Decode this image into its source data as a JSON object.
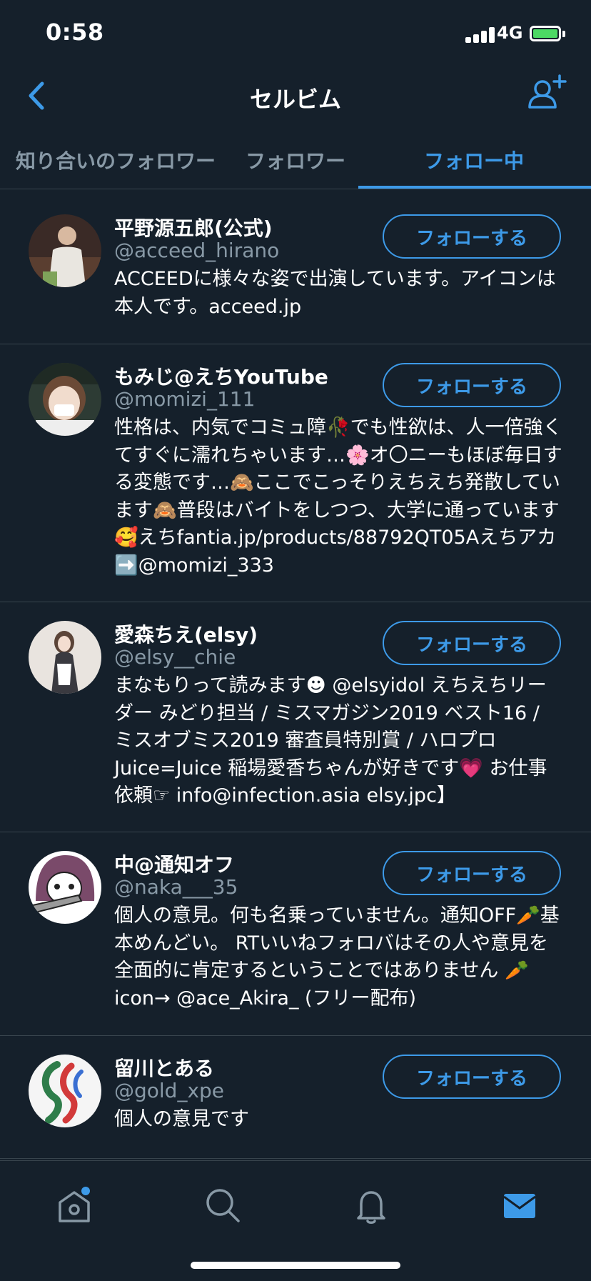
{
  "status_bar": {
    "time": "0:58",
    "network": "4G"
  },
  "header": {
    "title": "セルビム"
  },
  "tabs": [
    {
      "label": "知り合いのフォロワー",
      "active": false
    },
    {
      "label": "フォロワー",
      "active": false
    },
    {
      "label": "フォロー中",
      "active": true
    }
  ],
  "users": [
    {
      "name": "平野源五郎(公式)",
      "handle": "@acceed_hirano",
      "bio": "ACCEEDに様々な姿で出演しています。アイコンは本人です。acceed.jp",
      "button": "フォローする"
    },
    {
      "name": "もみじ@えちYouTube",
      "handle": "@momizi_111",
      "bio": "性格は、内気でコミュ障🥀でも性欲は、人一倍強くてすぐに濡れちゃいます…🌸オ〇ニーもほぼ毎日する変態です…🙈ここでこっそりえちえち発散しています🙈普段はバイトをしつつ、大学に通っています🥰えちfantia.jp/products/88792QT05Aえちアカ➡️@momizi_333",
      "button": "フォローする"
    },
    {
      "name": "愛森ちえ(elsy)",
      "handle": "@elsy__chie",
      "bio": "まなもりって読みます☻ @elsyidol えちえちリーダー みどり担当 / ミスマガジン2019 ベスト16 / ミスオブミス2019 審査員特別賞 / ハロプロ Juice=Juice 稲場愛香ちゃんが好きです💗 お仕事依頼☞ info@infection.asia elsy.jpc】",
      "button": "フォローする"
    },
    {
      "name": "中@通知オフ",
      "handle": "@naka___35",
      "bio": "個人の意見。何も名乗っていません。通知OFF🥕基本めんどい。 RTいいねフォロバはその人や意見を全面的に肯定するということではありません 🥕icon→ @ace_Akira_ (フリー配布)",
      "button": "フォローする"
    },
    {
      "name": "留川とある",
      "handle": "@gold_xpe",
      "bio": "個人の意見です",
      "button": "フォローする"
    }
  ],
  "colors": {
    "background": "#15202b",
    "accent": "#3d9ae8",
    "muted": "#8899a6",
    "divider": "#38444d"
  }
}
